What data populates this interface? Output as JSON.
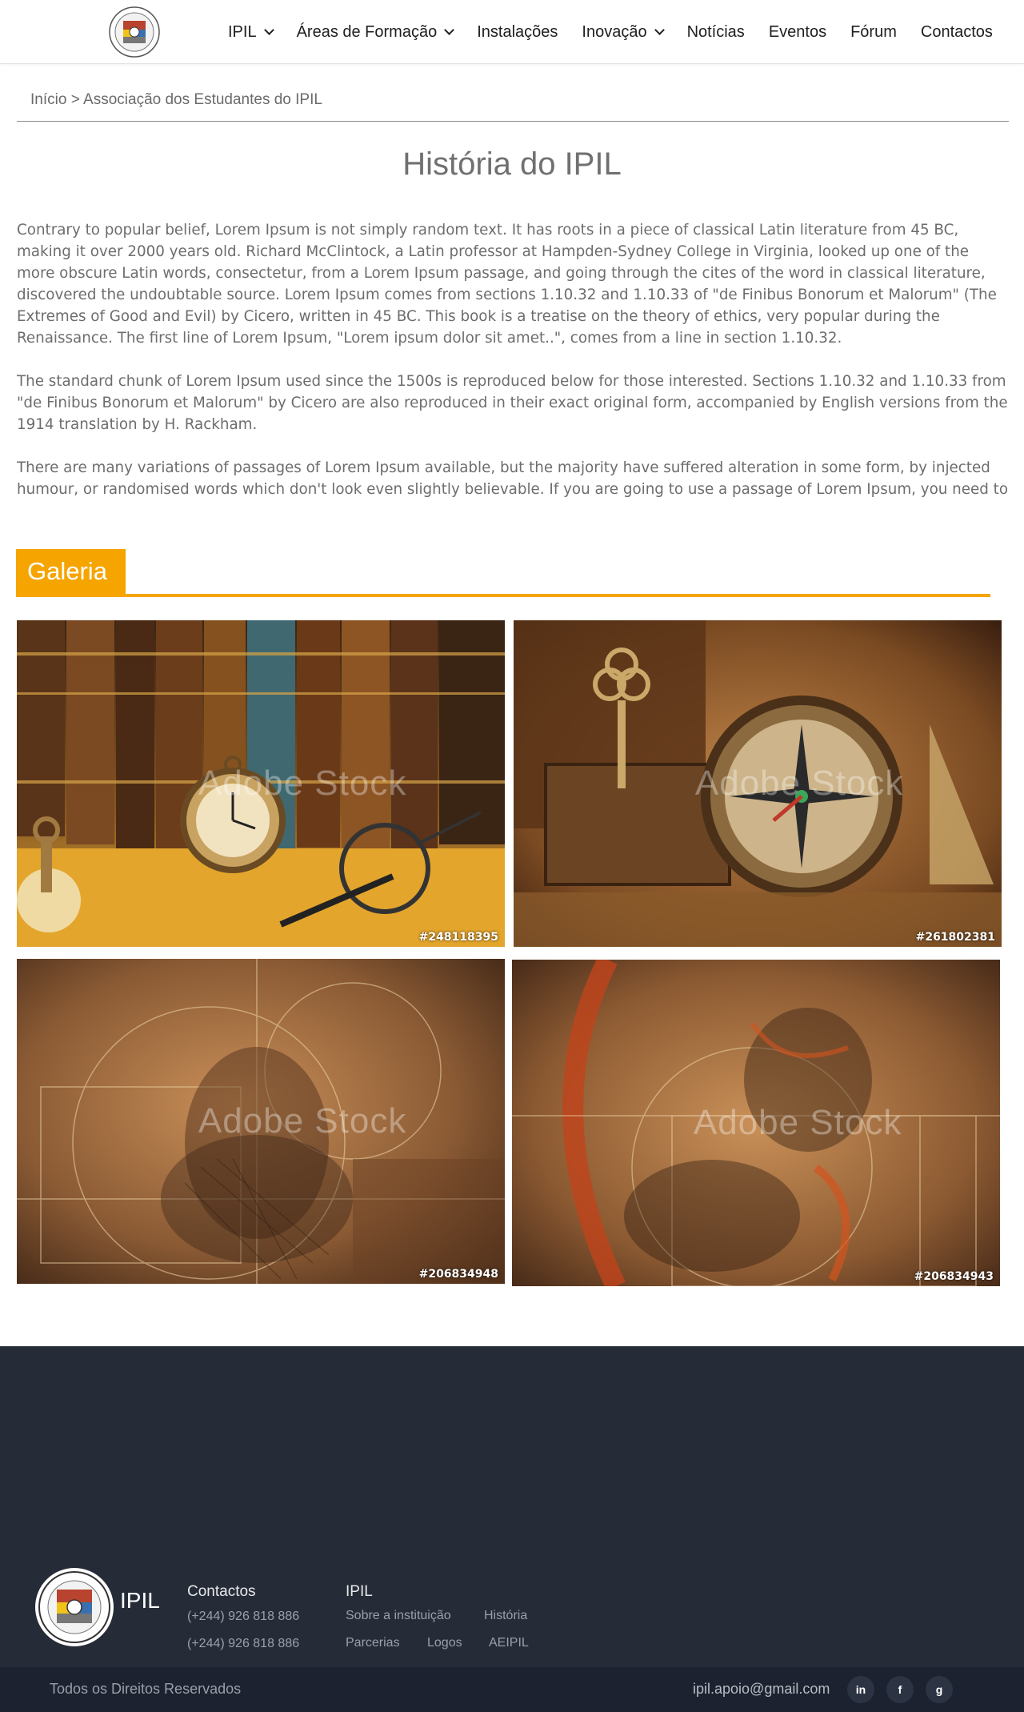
{
  "header": {
    "nav": [
      {
        "label": "IPIL",
        "has_dropdown": true
      },
      {
        "label": "Áreas de Formação",
        "has_dropdown": true
      },
      {
        "label": "Instalações",
        "has_dropdown": false
      },
      {
        "label": "Inovação",
        "has_dropdown": true
      },
      {
        "label": "Notícias",
        "has_dropdown": false
      },
      {
        "label": "Eventos",
        "has_dropdown": false
      },
      {
        "label": "Fórum",
        "has_dropdown": false
      },
      {
        "label": "Contactos",
        "has_dropdown": false
      }
    ]
  },
  "breadcrumb": {
    "home": "Início",
    "separator": ">",
    "current": "Associação dos Estudantes do IPIL"
  },
  "page_title": "História do IPIL",
  "article": {
    "paragraphs": [
      "Contrary to popular belief, Lorem Ipsum is not simply random text. It has roots in a piece of classical Latin literature from 45 BC, making it over 2000 years old. Richard McClintock, a Latin professor at Hampden-Sydney College in Virginia, looked up one of the more obscure Latin words, consectetur, from a Lorem Ipsum passage, and going through the cites of the word in classical literature, discovered the undoubtable source. Lorem Ipsum comes from sections 1.10.32 and 1.10.33 of \"de Finibus Bonorum et Malorum\" (The Extremes of Good and Evil) by Cicero, written in 45 BC. This book is a treatise on the theory of ethics, very popular during the Renaissance. The first line of Lorem Ipsum, \"Lorem ipsum dolor sit amet..\", comes from a line in section 1.10.32.",
      "The standard chunk of Lorem Ipsum used since the 1500s is reproduced below for those interested. Sections 1.10.32 and 1.10.33 from \"de Finibus Bonorum et Malorum\" by Cicero are also reproduced in their exact original form, accompanied by English versions from the 1914 translation by H. Rackham.",
      "There are many variations of passages of Lorem Ipsum available, but the majority have suffered alteration in some form, by injected humour, or randomised words which don't look even slightly believable. If you are going to use a passage of Lorem Ipsum, you need to be sure there"
    ]
  },
  "gallery": {
    "title": "Galeria",
    "accent_color": "#f5a400",
    "watermark": "Adobe Stock",
    "images": [
      {
        "id": "#248118395",
        "subject": "antique books, pocket watch and magnifying glass"
      },
      {
        "id": "#261802381",
        "subject": "antique compass and keys"
      },
      {
        "id": "#206834948",
        "subject": "Leonardo da Vinci sketch collage"
      },
      {
        "id": "#206834943",
        "subject": "Leonardo da Vinci sketch collage with red accents"
      }
    ]
  },
  "footer": {
    "background": "#252c38",
    "brand": "IPIL",
    "contacts": {
      "title": "Contactos",
      "phones": [
        "(+244) 926 818 886",
        "(+244) 926 818 886"
      ]
    },
    "ipil": {
      "title": "IPIL",
      "links": [
        "Sobre a instituição",
        "História",
        "Parcerias",
        "Logos",
        "AEIPIL"
      ]
    },
    "copyright": "Todos os Direitos Reservados",
    "email": "ipil.apoio@gmail.com",
    "social": [
      {
        "icon": "linkedin-icon",
        "glyph": "in"
      },
      {
        "icon": "facebook-icon",
        "glyph": "f"
      },
      {
        "icon": "google-icon",
        "glyph": "g"
      }
    ]
  }
}
